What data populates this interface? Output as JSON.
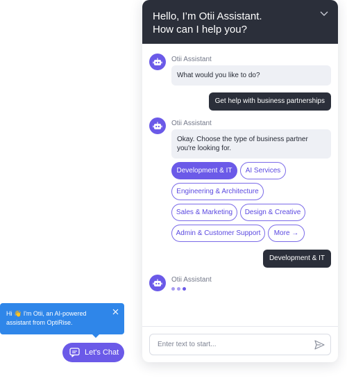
{
  "header": {
    "title": "Hello, I’m Otii Assistant.\nHow can I help you?"
  },
  "assistant_name": "Otii Assistant",
  "messages": {
    "bot1": "What would you like to do?",
    "user1": "Get help with business partnerships",
    "bot2": "Okay. Choose the type of business partner you're looking for.",
    "user2": "Development & IT"
  },
  "options": [
    {
      "label": "Development & IT",
      "selected": true
    },
    {
      "label": "AI Services",
      "selected": false
    },
    {
      "label": "Engineering & Architecture",
      "selected": false
    },
    {
      "label": "Sales & Marketing",
      "selected": false
    },
    {
      "label": "Design & Creative",
      "selected": false
    },
    {
      "label": "Admin & Customer Support",
      "selected": false
    },
    {
      "label": "More →",
      "selected": false
    }
  ],
  "input": {
    "placeholder": "Enter text to start..."
  },
  "tooltip": {
    "text": "Hi 👋 I'm Otii, an AI-powered assistant from OptiRise."
  },
  "launcher": {
    "label": "Let's Chat"
  },
  "icons": {
    "collapse": "chevron-down-icon",
    "avatar": "robot-icon",
    "send": "send-icon",
    "close": "close-icon",
    "chat": "chat-bubble-icon"
  },
  "colors": {
    "header_bg": "#2b2f3a",
    "accent": "#6b5ae8",
    "tooltip_bg": "#2f86e9",
    "bot_bubble": "#eef0f5"
  }
}
